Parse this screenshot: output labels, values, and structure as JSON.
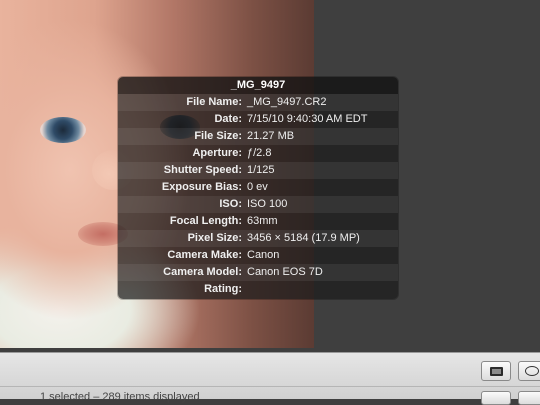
{
  "popup": {
    "title": "_MG_9497",
    "rows": [
      {
        "label": "File Name:",
        "value": "_MG_9497.CR2"
      },
      {
        "label": "Date:",
        "value": "7/15/10 9:40:30 AM EDT"
      },
      {
        "label": "File Size:",
        "value": "21.27 MB"
      },
      {
        "label": "Aperture:",
        "value": "ƒ/2.8"
      },
      {
        "label": "Shutter Speed:",
        "value": "1/125"
      },
      {
        "label": "Exposure Bias:",
        "value": "0 ev"
      },
      {
        "label": "ISO:",
        "value": "ISO 100"
      },
      {
        "label": "Focal Length:",
        "value": "63mm"
      },
      {
        "label": "Pixel Size:",
        "value": "3456 × 5184 (17.9 MP)"
      },
      {
        "label": "Camera Make:",
        "value": "Canon"
      },
      {
        "label": "Camera Model:",
        "value": "Canon EOS 7D"
      },
      {
        "label": "Rating:",
        "value": ""
      }
    ]
  },
  "status": {
    "text": "1 selected – 289 items displayed"
  },
  "icons": {
    "filmstrip": "filmstrip-icon",
    "viewer": "viewer-icon"
  }
}
